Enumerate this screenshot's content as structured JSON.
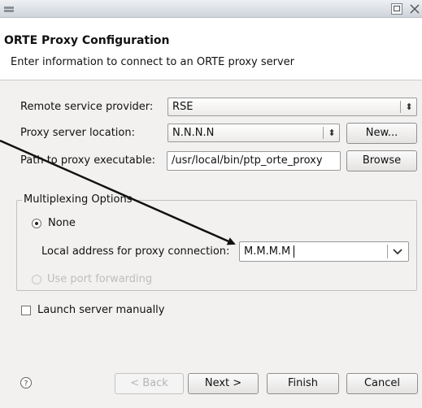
{
  "window": {
    "menu_icon": "window-menu-icon",
    "maximize_icon": "maximize-icon",
    "close_icon": "close-icon"
  },
  "banner": {
    "title": "ORTE Proxy Configuration",
    "description": "Enter information to connect to an ORTE proxy server"
  },
  "form": {
    "remote_provider_label": "Remote service provider:",
    "remote_provider_value": "RSE",
    "proxy_location_label": "Proxy server location:",
    "proxy_location_value": "N.N.N.N",
    "new_button": "New...",
    "path_label": "Path to proxy executable:",
    "path_value": "/usr/local/bin/ptp_orte_proxy",
    "browse_button": "Browse"
  },
  "multiplexing": {
    "group_label": "Multiplexing Options",
    "none_label": "None",
    "none_selected": true,
    "local_address_label": "Local address for proxy connection:",
    "local_address_value": "M.M.M.M",
    "port_forwarding_label": "Use port forwarding",
    "port_forwarding_enabled": false
  },
  "launch_manually": {
    "label": "Launch server manually",
    "checked": false
  },
  "footer": {
    "help_icon": "help-icon",
    "back_button": "< Back",
    "next_button": "Next >",
    "finish_button": "Finish",
    "cancel_button": "Cancel"
  },
  "colors": {
    "arrow": "#111111",
    "title_bar": "#d6dae0",
    "dialog_background": "#f2f1f0"
  }
}
